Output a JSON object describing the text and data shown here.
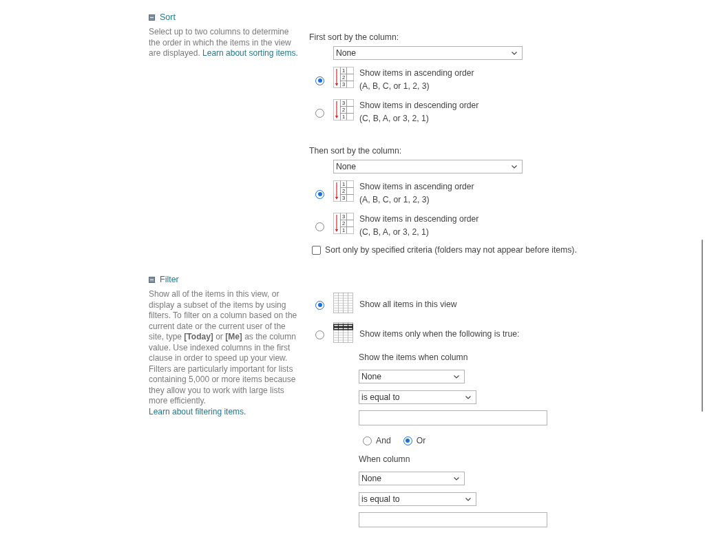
{
  "sections": [
    {
      "kind": "sort",
      "title": "Sort",
      "expanded": true,
      "description": "Select up to two columns to determine the order in which the items in the view are displayed.",
      "link": "Learn about sorting items.",
      "levels": [
        {
          "label": "First sort by the column:",
          "column": "None",
          "orders": [
            {
              "icon_digits": [
                "1",
                "2",
                "3"
              ],
              "label": "Show items in ascending order",
              "hint": "(A, B, C, or 1, 2, 3)",
              "selected": true
            },
            {
              "icon_digits": [
                "3",
                "2",
                "1"
              ],
              "label": "Show items in descending order",
              "hint": "(C, B, A, or 3, 2, 1)",
              "selected": false
            }
          ]
        },
        {
          "label": "Then sort by the column:",
          "column": "None",
          "orders": [
            {
              "icon_digits": [
                "1",
                "2",
                "3"
              ],
              "label": "Show items in ascending order",
              "hint": "(A, B, C, or 1, 2, 3)",
              "selected": true
            },
            {
              "icon_digits": [
                "3",
                "2",
                "1"
              ],
              "label": "Show items in descending order",
              "hint": "(C, B, A, or 3, 2, 1)",
              "selected": false
            }
          ]
        }
      ],
      "option": {
        "label": "Sort only by specified criteria (folders may not appear before items).",
        "checked": false
      }
    },
    {
      "kind": "filter",
      "title": "Filter",
      "expanded": true,
      "description": "Show all of the items in this view, or display a subset of the items by using filters. To filter on a column based on the current date or the current user of the site, type **[Today]** or **[Me]** as the column value. Use indexed columns in the first clause in order to speed up your view. Filters are particularly important for lists containing 5,000 or more items because they allow you to work with large lists more efficiently.",
      "link": "Learn about filtering items.",
      "modes": [
        {
          "kind": "all",
          "label": "Show all items in this view",
          "selected": true
        },
        {
          "kind": "conditional",
          "label": "Show items only when the following is true:",
          "selected": false
        }
      ],
      "clauses": [
        {
          "label": "Show the items when column",
          "column": "None",
          "operator": "is equal to"
        },
        {
          "label": "When column",
          "column": "None",
          "operator": "is equal to"
        }
      ],
      "joins": [
        {
          "label": "And",
          "selected": false
        },
        {
          "label": "Or",
          "selected": true
        }
      ]
    }
  ]
}
